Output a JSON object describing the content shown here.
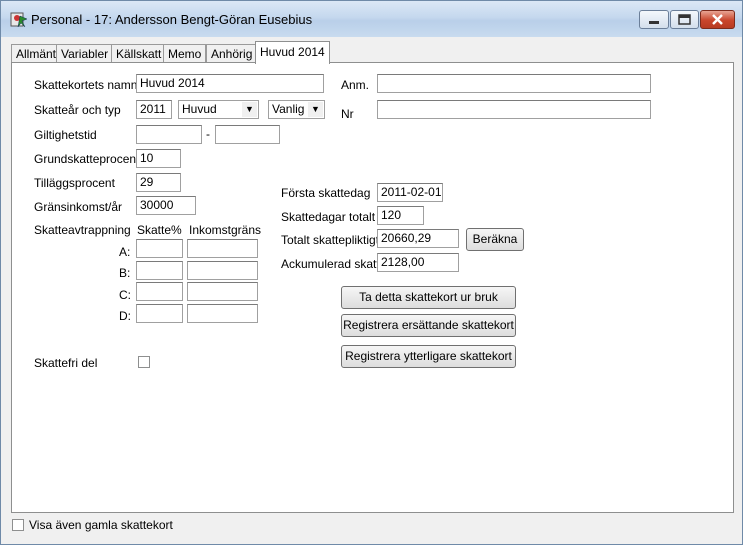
{
  "window": {
    "title": "Personal - 17: Andersson Bengt-Göran Eusebius"
  },
  "tabs": [
    {
      "label": "Allmänt"
    },
    {
      "label": "Variabler"
    },
    {
      "label": "Källskatt"
    },
    {
      "label": "Memo"
    },
    {
      "label": "Anhörig"
    },
    {
      "label": "Huvud 2014"
    }
  ],
  "form": {
    "namn_label": "Skattekortets namn",
    "namn_value": "Huvud 2014",
    "ar_typ_label": "Skatteår och typ",
    "ar_value": "2011",
    "typ_value": "Huvud",
    "variant_value": "Vanlig",
    "giltighet_label": "Giltighetstid",
    "giltighet_from": "",
    "giltighet_separator": "-",
    "giltighet_to": "",
    "grund_label": "Grundskatteprocent",
    "grund_value": "10",
    "tillagg_label": "Tilläggsprocent",
    "tillagg_value": "29",
    "grans_label": "Gränsinkomst/år",
    "grans_value": "30000",
    "avtrappning_label": "Skatteavtrappning",
    "skatte_pct_header": "Skatte%",
    "inkomstgrans_header": "Inkomstgräns",
    "rows": [
      {
        "label": "A:"
      },
      {
        "label": "B:"
      },
      {
        "label": "C:"
      },
      {
        "label": "D:"
      }
    ],
    "skattefri_label": "Skattefri del",
    "anm_label": "Anm.",
    "anm_value": "",
    "nr_label": "Nr",
    "nr_value": "",
    "forsta_label": "Första skattedag",
    "forsta_value": "2011-02-01",
    "dagar_label": "Skattedagar totalt",
    "dagar_value": "120",
    "totalt_label": "Totalt skattepliktigt",
    "totalt_value": "20660,29",
    "berakna_label": "Beräkna",
    "ackumulerad_label": "Ackumulerad skatt",
    "ackumulerad_value": "2128,00",
    "ta_ur_bruk_label": "Ta detta skattekort ur bruk",
    "ersattande_label": "Registrera ersättande skattekort",
    "ytterligare_label": "Registrera ytterligare skattekort"
  },
  "footer": {
    "visa_gamla_label": "Visa även gamla skattekort"
  }
}
